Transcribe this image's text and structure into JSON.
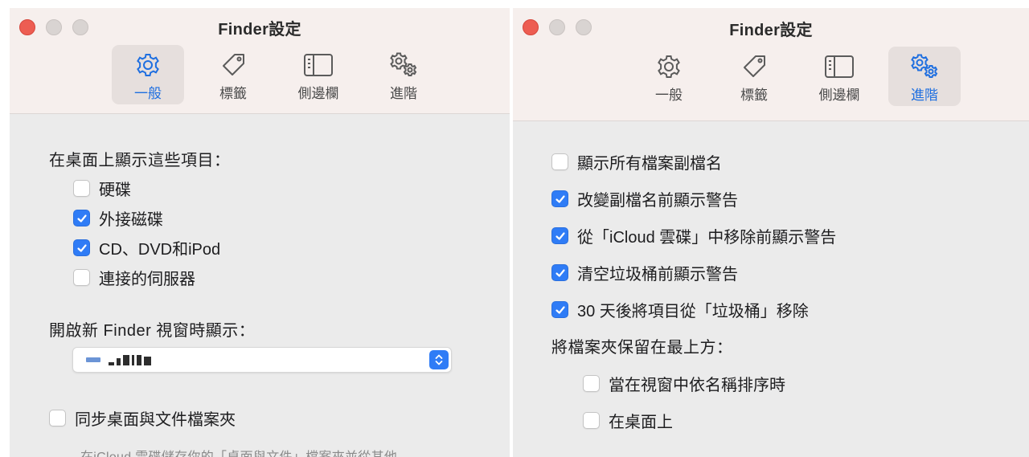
{
  "left_window": {
    "title": "Finder設定",
    "tabs": [
      {
        "label": "一般",
        "icon": "gear-icon",
        "active": true
      },
      {
        "label": "標籤",
        "icon": "tag-icon",
        "active": false
      },
      {
        "label": "側邊欄",
        "icon": "sidebar-icon",
        "active": false
      },
      {
        "label": "進階",
        "icon": "gears-icon",
        "active": false
      }
    ],
    "desktop_heading": "在桌面上顯示這些項目：",
    "desktop_items": [
      {
        "label": "硬碟",
        "checked": false
      },
      {
        "label": "外接磁碟",
        "checked": true
      },
      {
        "label": "CD、DVD和iPod",
        "checked": true
      },
      {
        "label": "連接的伺服器",
        "checked": false
      }
    ],
    "new_window_heading": "開啟新 Finder 視窗時顯示：",
    "new_window_value": "",
    "sync": {
      "label": "同步桌面與文件檔案夾",
      "checked": false
    },
    "sync_note": "在iCloud 雲碟儲存你的「桌面與文件」檔案夾並從其他"
  },
  "right_window": {
    "title": "Finder設定",
    "tabs": [
      {
        "label": "一般",
        "icon": "gear-icon",
        "active": false
      },
      {
        "label": "標籤",
        "icon": "tag-icon",
        "active": false
      },
      {
        "label": "側邊欄",
        "icon": "sidebar-icon",
        "active": false
      },
      {
        "label": "進階",
        "icon": "gears-icon",
        "active": true
      }
    ],
    "options": [
      {
        "label": "顯示所有檔案副檔名",
        "checked": false
      },
      {
        "label": "改變副檔名前顯示警告",
        "checked": true
      },
      {
        "label": "從「iCloud 雲碟」中移除前顯示警告",
        "checked": true
      },
      {
        "label": "清空垃圾桶前顯示警告",
        "checked": true
      },
      {
        "label": "30 天後將項目從「垃圾桶」移除",
        "checked": true
      }
    ],
    "folders_heading": "將檔案夾保留在最上方：",
    "folder_options": [
      {
        "label": "當在視窗中依名稱排序時",
        "checked": false
      },
      {
        "label": "在桌面上",
        "checked": false
      }
    ]
  },
  "colors": {
    "accent": "#2f7cf6",
    "active_tab_text": "#1f6fe0",
    "close_button": "#ed5d52"
  }
}
